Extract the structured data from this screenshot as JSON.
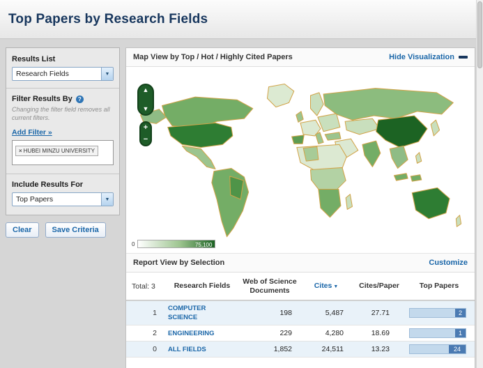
{
  "page": {
    "title": "Top Papers by Research Fields"
  },
  "icons": {
    "dropdown": "▼",
    "help": "?",
    "remove": "×",
    "pan_up": "▲",
    "pan_down": "▼",
    "zoom_in": "+",
    "zoom_out": "−",
    "sort_desc": "▼"
  },
  "sidebar": {
    "results_list_label": "Results List",
    "results_list_value": "Research Fields",
    "filter_by_label": "Filter Results By",
    "filter_note": "Changing the filter field removes all current filters.",
    "add_filter_link": "Add Filter »",
    "filter_tag": "HUBEI MINZU UNIVERSITY",
    "include_results_label": "Include Results For",
    "include_results_value": "Top Papers",
    "clear_button": "Clear",
    "save_button": "Save Criteria"
  },
  "map_section": {
    "title": "Map View by Top / Hot / Highly Cited Papers",
    "hide_link": "Hide Visualization",
    "legend_min": "0",
    "legend_max": "75,100"
  },
  "report_section": {
    "title": "Report View by Selection",
    "customize_link": "Customize",
    "total_label": "Total: 3",
    "columns": {
      "field": "Research Fields",
      "documents": "Web of Science Documents",
      "cites": "Cites",
      "cites_per_paper": "Cites/Paper",
      "top_papers": "Top Papers"
    },
    "sorted_column": "Cites",
    "rows": [
      {
        "rank": "1",
        "field": "COMPUTER SCIENCE",
        "documents": "198",
        "cites": "5,487",
        "cites_per_paper": "27.71",
        "top_papers": "2"
      },
      {
        "rank": "2",
        "field": "ENGINEERING",
        "documents": "229",
        "cites": "4,280",
        "cites_per_paper": "18.69",
        "top_papers": "1"
      },
      {
        "rank": "0",
        "field": "ALL FIELDS",
        "documents": "1,852",
        "cites": "24,511",
        "cites_per_paper": "13.23",
        "top_papers": "24"
      }
    ]
  },
  "colors": {
    "title_text": "#17365d",
    "link_blue": "#1a66a8",
    "map_min": "#ffffff",
    "map_max": "#1c6323",
    "country_border": "#d1a348",
    "bar_track": "#c3d9ec",
    "bar_fill": "#4a7ab2",
    "row_alt": "#e9f2f9"
  }
}
